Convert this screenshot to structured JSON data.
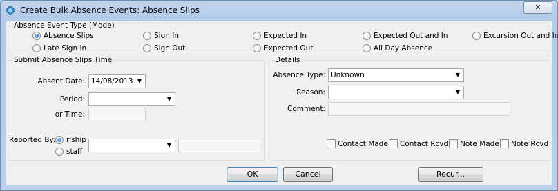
{
  "window": {
    "title": "Create Bulk Absence Events: Absence Slips",
    "close_label": "✕"
  },
  "mode": {
    "legend": "Absence Event Type (Mode)",
    "options": [
      {
        "label": "Absence Slips",
        "selected": true
      },
      {
        "label": "Sign In",
        "selected": false
      },
      {
        "label": "Expected In",
        "selected": false
      },
      {
        "label": "Expected Out and In",
        "selected": false
      },
      {
        "label": "Excursion Out and In",
        "selected": false
      },
      {
        "label": "Late Sign In",
        "selected": false
      },
      {
        "label": "Sign Out",
        "selected": false
      },
      {
        "label": "Expected Out",
        "selected": false
      },
      {
        "label": "All Day Absence",
        "selected": false
      }
    ]
  },
  "submit": {
    "legend": "Submit Absence Slips Time",
    "absent_date_label": "Absent Date:",
    "absent_date_value": "14/08/2013",
    "period_label": "Period:",
    "period_value": "",
    "or_time_label": "or Time:",
    "or_time_value": "",
    "reported_by_label": "Reported By:",
    "reported_by_options": [
      {
        "label": "r'ship",
        "selected": true
      },
      {
        "label": "staff",
        "selected": false
      }
    ],
    "reported_by_value": "",
    "reported_by_text": ""
  },
  "details": {
    "legend": "Details",
    "absence_type_label": "Absence Type:",
    "absence_type_value": "Unknown",
    "reason_label": "Reason:",
    "reason_value": "",
    "comment_label": "Comment:",
    "comment_value": "",
    "checks": [
      {
        "label": "Contact Made",
        "checked": false
      },
      {
        "label": "Contact Rcvd",
        "checked": false
      },
      {
        "label": "Note Made",
        "checked": false
      },
      {
        "label": "Note Rcvd",
        "checked": false
      }
    ]
  },
  "buttons": {
    "ok": "OK",
    "cancel": "Cancel",
    "recur": "Recur..."
  }
}
